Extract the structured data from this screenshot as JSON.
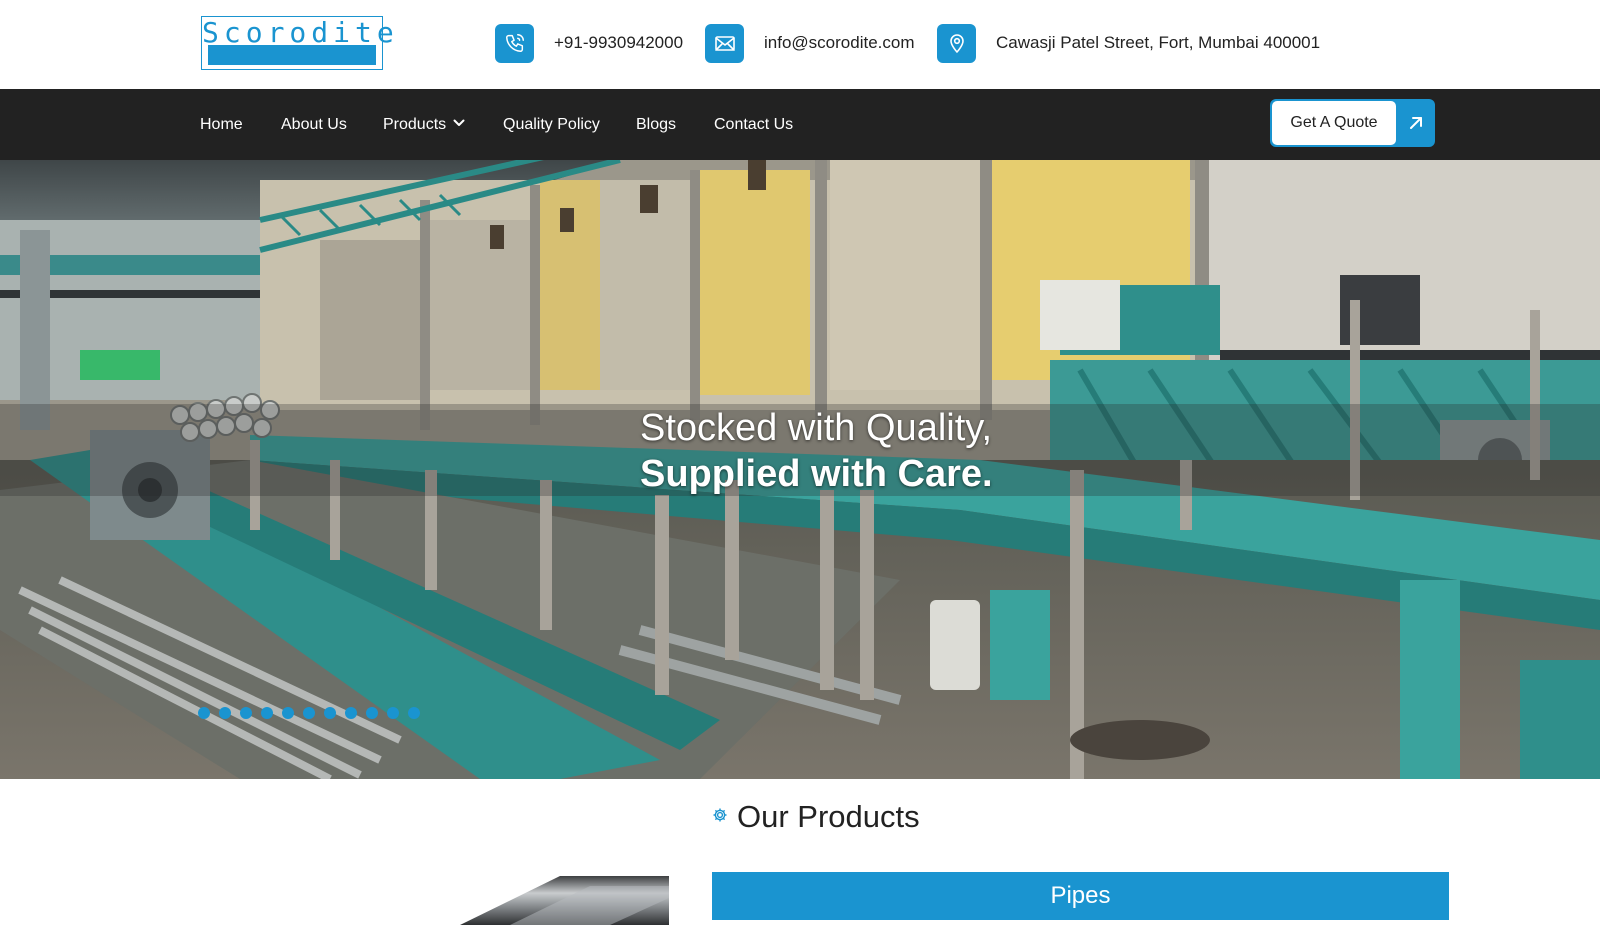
{
  "brand": {
    "logo_text": "Scorodite"
  },
  "contact": {
    "phone": "+91-9930942000",
    "email": "info@scorodite.com",
    "address": "Cawasji Patel Street, Fort, Mumbai 400001",
    "icons": [
      "phone-icon",
      "mail-icon",
      "location-pin-icon"
    ]
  },
  "nav": {
    "items": [
      {
        "label": "Home"
      },
      {
        "label": "About Us"
      },
      {
        "label": "Products",
        "has_dropdown": true
      },
      {
        "label": "Quality Policy"
      },
      {
        "label": "Blogs"
      },
      {
        "label": "Contact Us"
      }
    ],
    "cta_label": "Get A Quote"
  },
  "hero": {
    "line1": "Stocked with Quality,",
    "line2": "Supplied with Care.",
    "slide_count": 11,
    "active_slide": 1
  },
  "products": {
    "section_title": "Our Products",
    "first_category": "Pipes"
  },
  "colors": {
    "accent": "#1a94d0",
    "nav_bg": "#222222",
    "text": "#222222"
  }
}
